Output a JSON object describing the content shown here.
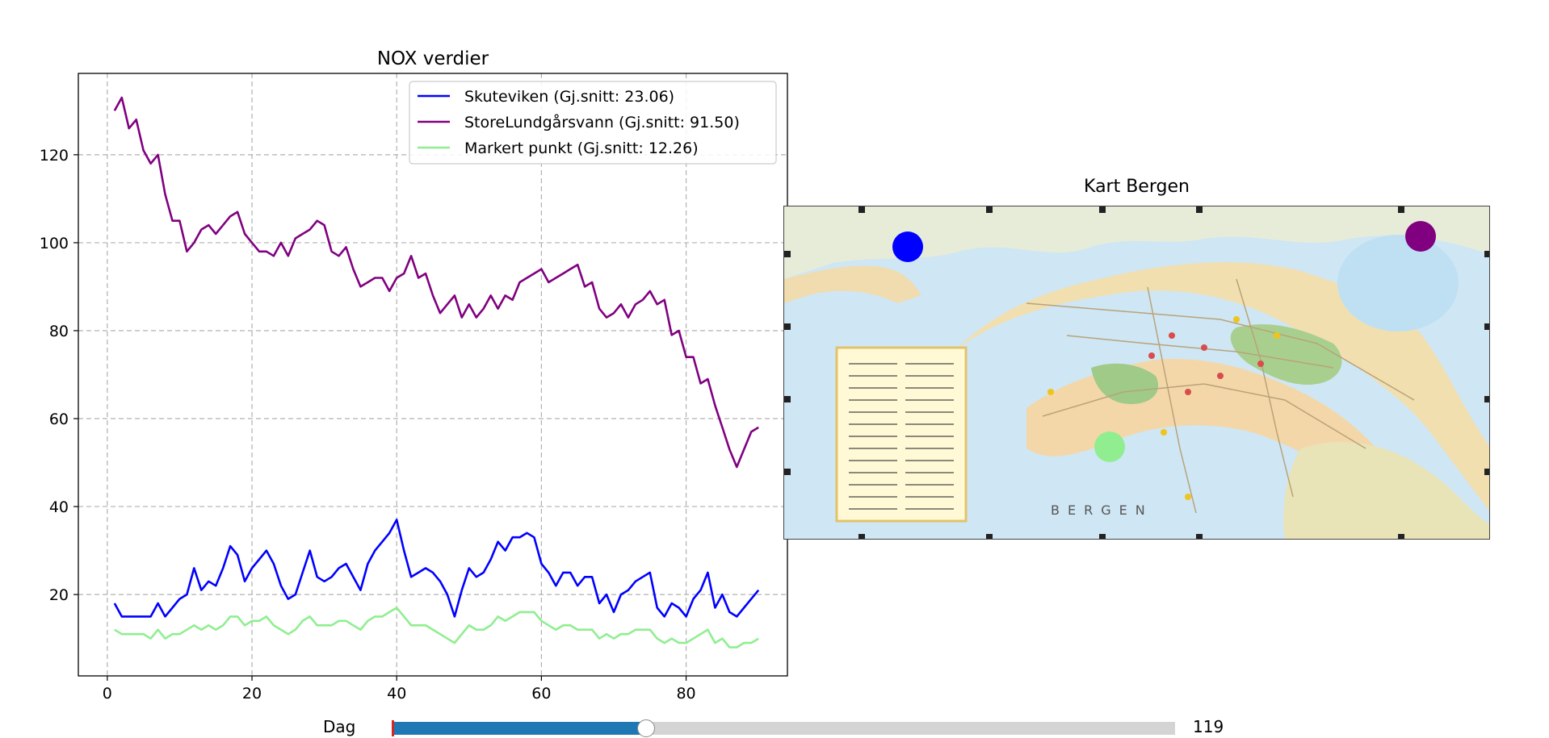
{
  "chart_data": [
    {
      "type": "line",
      "title": "NOX verdier",
      "xlabel": "",
      "ylabel": "",
      "xlim": [
        -4,
        94
      ],
      "ylim": [
        1.5,
        138.5
      ],
      "xticks": [
        0,
        20,
        40,
        60,
        80
      ],
      "yticks": [
        20,
        40,
        60,
        80,
        100,
        120
      ],
      "grid": true,
      "legend_position": "top-right",
      "x": [
        1,
        2,
        3,
        4,
        5,
        6,
        7,
        8,
        9,
        10,
        11,
        12,
        13,
        14,
        15,
        16,
        17,
        18,
        19,
        20,
        21,
        22,
        23,
        24,
        25,
        26,
        27,
        28,
        29,
        30,
        31,
        32,
        33,
        34,
        35,
        36,
        37,
        38,
        39,
        40,
        41,
        42,
        43,
        44,
        45,
        46,
        47,
        48,
        49,
        50,
        51,
        52,
        53,
        54,
        55,
        56,
        57,
        58,
        59,
        60,
        61,
        62,
        63,
        64,
        65,
        66,
        67,
        68,
        69,
        70,
        71,
        72,
        73,
        74,
        75,
        76,
        77,
        78,
        79,
        80,
        81,
        82,
        83,
        84,
        85,
        86,
        87,
        88,
        89,
        90
      ],
      "series": [
        {
          "name": "Skuteviken (Gj.snitt: 23.06)",
          "color": "#0000ff",
          "values": [
            18,
            15,
            15,
            15,
            15,
            15,
            18,
            15,
            17,
            19,
            20,
            26,
            21,
            23,
            22,
            26,
            31,
            29,
            23,
            26,
            28,
            30,
            27,
            22,
            19,
            20,
            25,
            30,
            24,
            23,
            24,
            26,
            27,
            24,
            21,
            27,
            30,
            32,
            34,
            37,
            30,
            24,
            25,
            26,
            25,
            23,
            20,
            15,
            21,
            26,
            24,
            25,
            28,
            32,
            30,
            33,
            33,
            34,
            33,
            27,
            25,
            22,
            25,
            25,
            22,
            24,
            24,
            18,
            20,
            16,
            20,
            21,
            23,
            24,
            25,
            17,
            15,
            18,
            17,
            15,
            19,
            21,
            25,
            17,
            20,
            16,
            15,
            17,
            19,
            21
          ],
          "values_note": ""
        },
        {
          "name": "StoreLundgårsvann (Gj.snitt: 91.50)",
          "color": "#800080",
          "values": [
            130,
            133,
            126,
            128,
            121,
            118,
            120,
            111,
            105,
            105,
            98,
            100,
            103,
            104,
            102,
            104,
            106,
            107,
            102,
            100,
            98,
            98,
            97,
            100,
            97,
            101,
            102,
            103,
            105,
            104,
            98,
            97,
            99,
            94,
            90,
            91,
            92,
            92,
            89,
            92,
            93,
            97,
            92,
            93,
            88,
            84,
            86,
            88,
            83,
            86,
            83,
            85,
            88,
            85,
            88,
            87,
            91,
            92,
            93,
            94,
            91,
            92,
            93,
            94,
            95,
            90,
            91,
            85,
            83,
            84,
            86,
            83,
            86,
            87,
            89,
            86,
            87,
            79,
            80,
            74,
            74,
            68,
            69,
            63,
            58,
            53,
            49,
            53,
            57,
            58
          ],
          "values_note": ""
        },
        {
          "name": "Markert punkt (Gj.snitt: 12.26)",
          "color": "#90ee90",
          "values": [
            12,
            11,
            11,
            11,
            11,
            10,
            12,
            10,
            11,
            11,
            12,
            13,
            12,
            13,
            12,
            13,
            15,
            15,
            13,
            14,
            14,
            15,
            13,
            12,
            11,
            12,
            14,
            15,
            13,
            13,
            13,
            14,
            14,
            13,
            12,
            14,
            15,
            15,
            16,
            17,
            15,
            13,
            13,
            13,
            12,
            11,
            10,
            9,
            11,
            13,
            12,
            12,
            13,
            15,
            14,
            15,
            16,
            16,
            16,
            14,
            13,
            12,
            13,
            13,
            12,
            12,
            12,
            10,
            11,
            10,
            11,
            11,
            12,
            12,
            12,
            10,
            9,
            10,
            9,
            9,
            10,
            11,
            12,
            9,
            10,
            8,
            8,
            9,
            9,
            10
          ],
          "values_note": ""
        }
      ]
    },
    {
      "type": "image",
      "title": "Kart Bergen",
      "markers": [
        {
          "name": "Skuteviken",
          "color": "#0000ff",
          "x": 0.175,
          "y": 0.12
        },
        {
          "name": "StoreLundgårsvann",
          "color": "#800080",
          "x": 0.9,
          "y": 0.09
        },
        {
          "name": "Markert punkt",
          "color": "#90ee90",
          "x": 0.46,
          "y": 0.72
        }
      ]
    }
  ],
  "slider": {
    "label": "Dag",
    "value": "119",
    "fraction": 0.325
  },
  "map_labels": {
    "city": "BERGEN"
  }
}
